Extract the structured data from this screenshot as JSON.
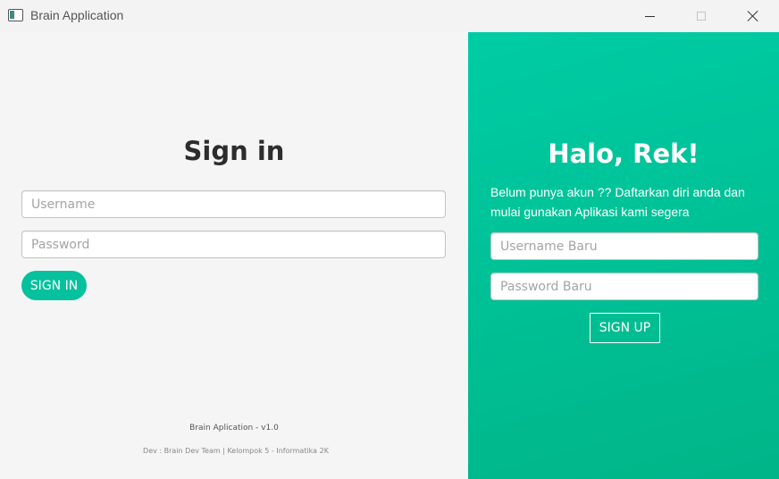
{
  "window": {
    "title": "Brain Application",
    "controls": {
      "minimize_icon": "minimize-icon",
      "maximize_icon": "maximize-icon",
      "close_icon": "close-icon"
    }
  },
  "signin": {
    "title": "Sign in",
    "username_placeholder": "Username",
    "password_placeholder": "Password",
    "button_label": "SIGN IN"
  },
  "footer": {
    "version": "Brain Aplication - v1.0",
    "credit": "Dev : Brain Dev Team | Kelompok 5 - Informatika 2K"
  },
  "signup": {
    "title": "Halo, Rek!",
    "invite": "Belum punya akun ?? Daftarkan diri anda dan mulai gunakan Aplikasi kami segera",
    "username_placeholder": "Username Baru",
    "password_placeholder": "Password Baru",
    "button_label": "SIGN UP"
  },
  "colors": {
    "accent": "#05c19d",
    "panel_gradient_start": "#00cca4",
    "panel_gradient_end": "#00b588",
    "left_background": "#f5f5f5",
    "title_text": "#2d2d2d"
  }
}
